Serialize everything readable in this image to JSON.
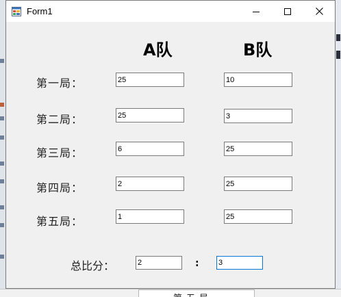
{
  "window": {
    "title": "Form1"
  },
  "headers": {
    "team_a": "A队",
    "team_b": "B队"
  },
  "rounds": [
    {
      "label": "第一局：",
      "a": "25",
      "b": "10"
    },
    {
      "label": "第二局：",
      "a": "25",
      "b": "3"
    },
    {
      "label": "第三局：",
      "a": "6",
      "b": "25"
    },
    {
      "label": "第四局：",
      "a": "2",
      "b": "25"
    },
    {
      "label": "第五局：",
      "a": "1",
      "b": "25"
    }
  ],
  "total": {
    "label": "总比分：",
    "a": "2",
    "separator": ":",
    "b": "3"
  },
  "background": {
    "fragment_text": "第五局"
  },
  "icons": {
    "app": "form-app-icon",
    "minimize": "minimize-icon",
    "maximize": "maximize-icon",
    "close": "close-icon"
  },
  "colors": {
    "window_bg": "#f0f0f0",
    "focus_border": "#0078d7",
    "textbox_border": "#7a7a7a"
  }
}
